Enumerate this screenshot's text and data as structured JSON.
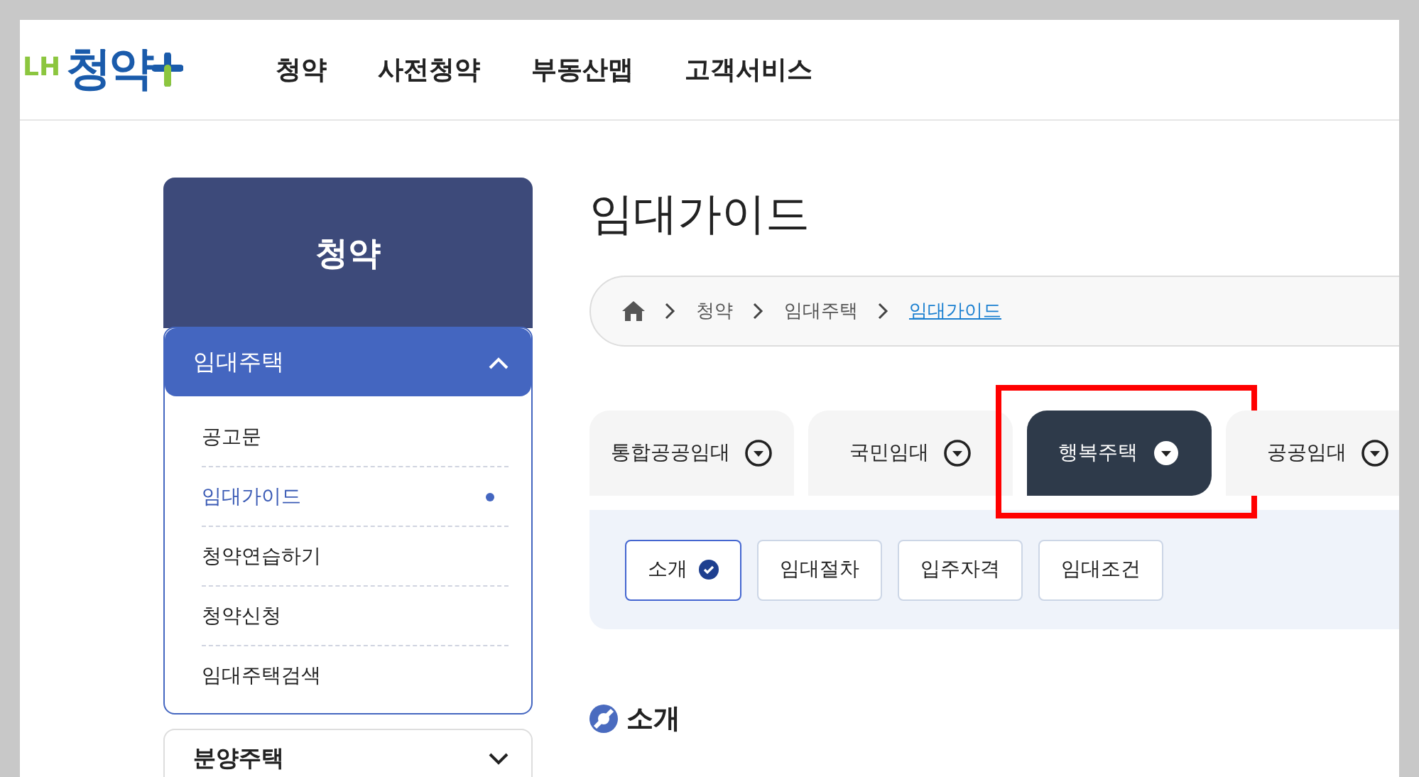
{
  "header": {
    "logo": {
      "prefix": "LH",
      "name": "청약"
    },
    "nav": [
      "청약",
      "사전청약",
      "부동산맵",
      "고객서비스"
    ]
  },
  "sidebar": {
    "title": "청약",
    "sections": [
      {
        "label": "임대주택",
        "expanded": true,
        "items": [
          {
            "label": "공고문",
            "selected": false
          },
          {
            "label": "임대가이드",
            "selected": true
          },
          {
            "label": "청약연습하기",
            "selected": false
          },
          {
            "label": "청약신청",
            "selected": false
          },
          {
            "label": "임대주택검색",
            "selected": false
          }
        ]
      },
      {
        "label": "분양주택",
        "expanded": false
      }
    ]
  },
  "page_title": "임대가이드",
  "breadcrumb": [
    "청약",
    "임대주택",
    "임대가이드"
  ],
  "tabs": [
    {
      "label": "통합공공임대",
      "selected": false,
      "highlighted": false
    },
    {
      "label": "국민임대",
      "selected": false,
      "highlighted": false
    },
    {
      "label": "행복주택",
      "selected": true,
      "highlighted": true
    },
    {
      "label": "공공임대",
      "selected": false,
      "highlighted": false
    }
  ],
  "subtabs": [
    {
      "label": "소개",
      "selected": true
    },
    {
      "label": "임대절차",
      "selected": false
    },
    {
      "label": "입주자격",
      "selected": false
    },
    {
      "label": "임대조건",
      "selected": false
    }
  ],
  "section_heading": "소개"
}
